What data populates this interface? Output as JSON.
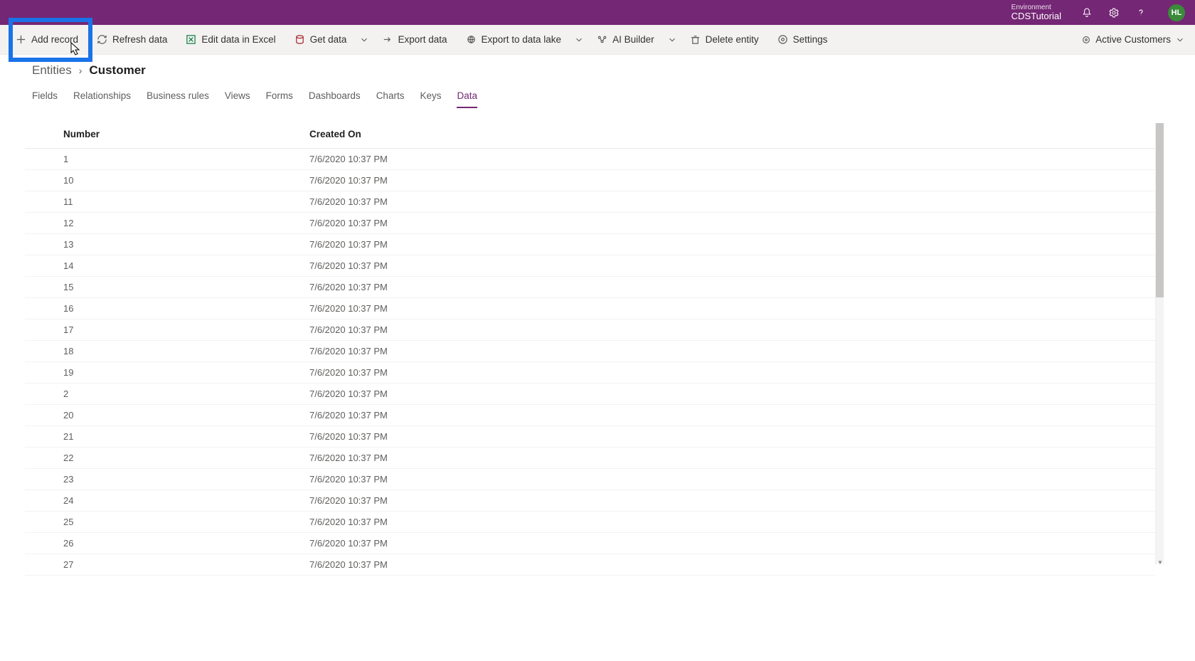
{
  "header": {
    "env_label": "Environment",
    "env_name": "CDSTutorial",
    "avatar_initials": "HL"
  },
  "commands": {
    "add_record": "Add record",
    "refresh_data": "Refresh data",
    "edit_excel": "Edit data in Excel",
    "get_data": "Get data",
    "export_data": "Export data",
    "export_lake": "Export to data lake",
    "ai_builder": "AI Builder",
    "delete_entity": "Delete entity",
    "settings": "Settings",
    "view_selector": "Active Customers"
  },
  "breadcrumb": {
    "parent": "Entities",
    "current": "Customer"
  },
  "tabs": [
    {
      "label": "Fields",
      "active": false
    },
    {
      "label": "Relationships",
      "active": false
    },
    {
      "label": "Business rules",
      "active": false
    },
    {
      "label": "Views",
      "active": false
    },
    {
      "label": "Forms",
      "active": false
    },
    {
      "label": "Dashboards",
      "active": false
    },
    {
      "label": "Charts",
      "active": false
    },
    {
      "label": "Keys",
      "active": false
    },
    {
      "label": "Data",
      "active": true
    }
  ],
  "columns": {
    "number": "Number",
    "created_on": "Created On"
  },
  "rows": [
    {
      "number": "1",
      "created": "7/6/2020 10:37 PM"
    },
    {
      "number": "10",
      "created": "7/6/2020 10:37 PM"
    },
    {
      "number": "11",
      "created": "7/6/2020 10:37 PM"
    },
    {
      "number": "12",
      "created": "7/6/2020 10:37 PM"
    },
    {
      "number": "13",
      "created": "7/6/2020 10:37 PM"
    },
    {
      "number": "14",
      "created": "7/6/2020 10:37 PM"
    },
    {
      "number": "15",
      "created": "7/6/2020 10:37 PM"
    },
    {
      "number": "16",
      "created": "7/6/2020 10:37 PM"
    },
    {
      "number": "17",
      "created": "7/6/2020 10:37 PM"
    },
    {
      "number": "18",
      "created": "7/6/2020 10:37 PM"
    },
    {
      "number": "19",
      "created": "7/6/2020 10:37 PM"
    },
    {
      "number": "2",
      "created": "7/6/2020 10:37 PM"
    },
    {
      "number": "20",
      "created": "7/6/2020 10:37 PM"
    },
    {
      "number": "21",
      "created": "7/6/2020 10:37 PM"
    },
    {
      "number": "22",
      "created": "7/6/2020 10:37 PM"
    },
    {
      "number": "23",
      "created": "7/6/2020 10:37 PM"
    },
    {
      "number": "24",
      "created": "7/6/2020 10:37 PM"
    },
    {
      "number": "25",
      "created": "7/6/2020 10:37 PM"
    },
    {
      "number": "26",
      "created": "7/6/2020 10:37 PM"
    },
    {
      "number": "27",
      "created": "7/6/2020 10:37 PM"
    }
  ]
}
